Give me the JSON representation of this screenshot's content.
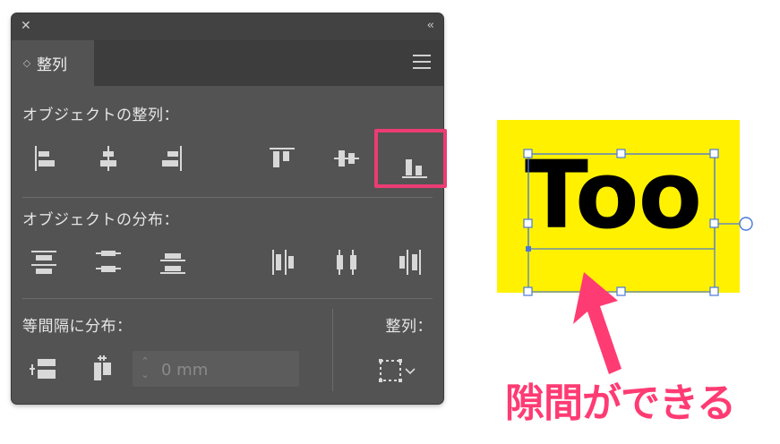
{
  "panel": {
    "close_glyph": "✕",
    "collapse_glyph": "‹‹",
    "tab_chevron": "◇",
    "tab_label": "整列",
    "menu_icon": "hamburger-menu-icon",
    "sections": {
      "align_objects": "オブジェクトの整列：",
      "distribute_objects": "オブジェクトの分布：",
      "distribute_spacing": "等間隔に分布：",
      "align_to": "整列："
    },
    "align_buttons": [
      "align-left-edge-icon",
      "align-horizontal-center-icon",
      "align-right-edge-icon",
      "align-top-edge-icon",
      "align-vertical-center-icon",
      "align-bottom-edge-icon"
    ],
    "distribute_buttons": [
      "distribute-top-icon",
      "distribute-vertical-center-icon",
      "distribute-bottom-icon",
      "distribute-left-icon",
      "distribute-horizontal-center-icon",
      "distribute-right-icon"
    ],
    "spacing_value_placeholder": "0 mm",
    "highlight_color": "#ec3c73"
  },
  "canvas": {
    "sample_text": "Too",
    "background_color": "#fff100",
    "selection_color": "#4a78d8"
  },
  "annotation": {
    "caption": "隙間ができる",
    "color": "#ff3b73"
  }
}
